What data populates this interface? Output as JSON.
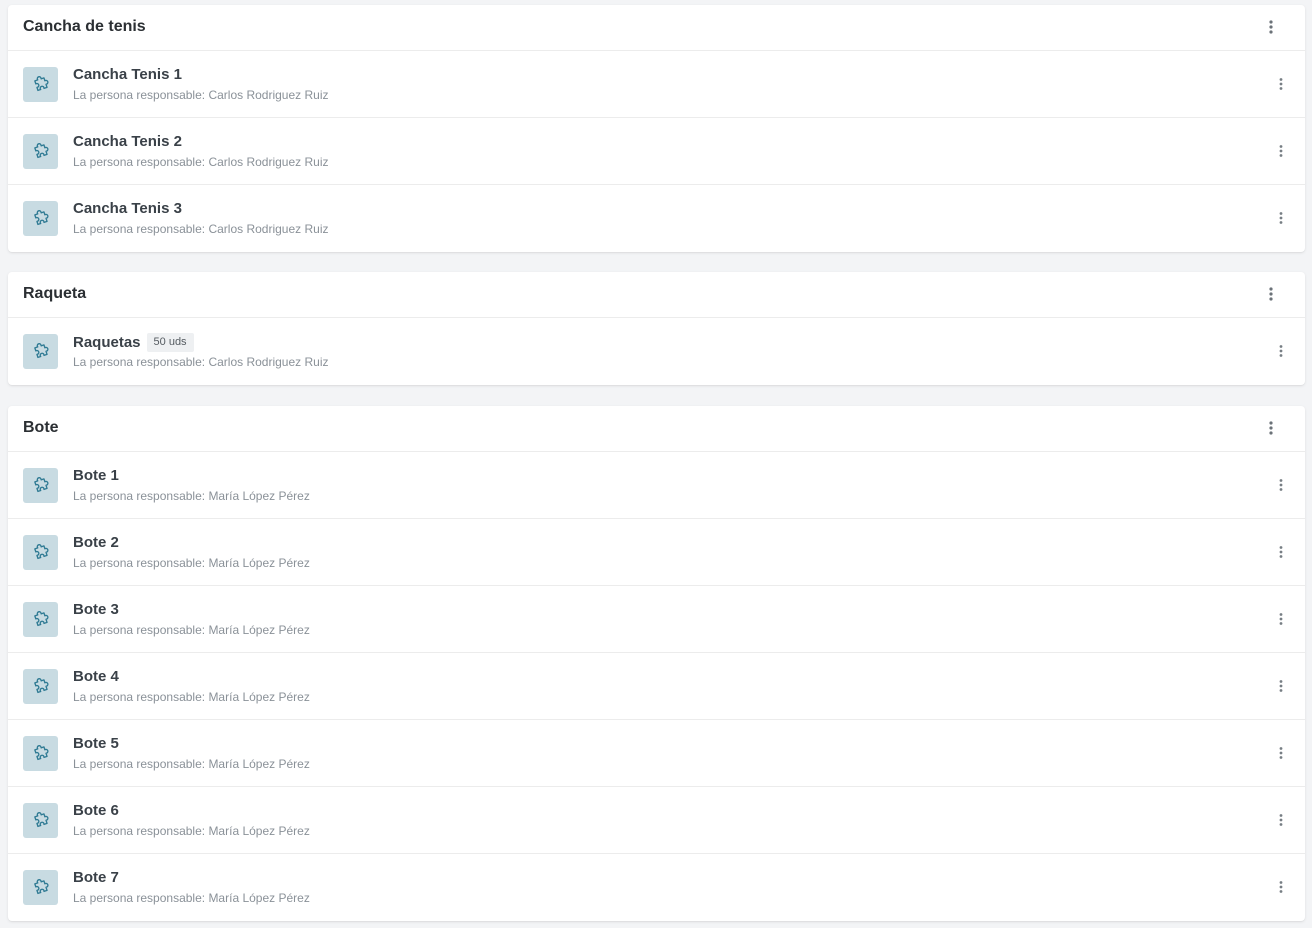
{
  "responsible_label": "La persona responsable: ",
  "groups": [
    {
      "title": "Cancha de tenis",
      "items": [
        {
          "name": "Cancha Tenis 1",
          "responsible": "Carlos Rodriguez Ruiz"
        },
        {
          "name": "Cancha Tenis 2",
          "responsible": "Carlos Rodriguez Ruiz"
        },
        {
          "name": "Cancha Tenis 3",
          "responsible": "Carlos Rodriguez Ruiz"
        }
      ]
    },
    {
      "title": "Raqueta",
      "items": [
        {
          "name": "Raquetas",
          "badge": "50 uds",
          "responsible": "Carlos Rodriguez Ruiz"
        }
      ]
    },
    {
      "title": "Bote",
      "items": [
        {
          "name": "Bote 1",
          "responsible": "María López Pérez"
        },
        {
          "name": "Bote 2",
          "responsible": "María López Pérez"
        },
        {
          "name": "Bote 3",
          "responsible": "María López Pérez"
        },
        {
          "name": "Bote 4",
          "responsible": "María López Pérez"
        },
        {
          "name": "Bote 5",
          "responsible": "María López Pérez"
        },
        {
          "name": "Bote 6",
          "responsible": "María López Pérez"
        },
        {
          "name": "Bote 7",
          "responsible": "María López Pérez"
        }
      ]
    }
  ],
  "icons": {
    "item": "puzzle-piece-icon",
    "menu": "more-vertical-icon"
  },
  "colors": {
    "icon_bg": "#c8dbe2",
    "icon_stroke": "#2f7a93"
  }
}
